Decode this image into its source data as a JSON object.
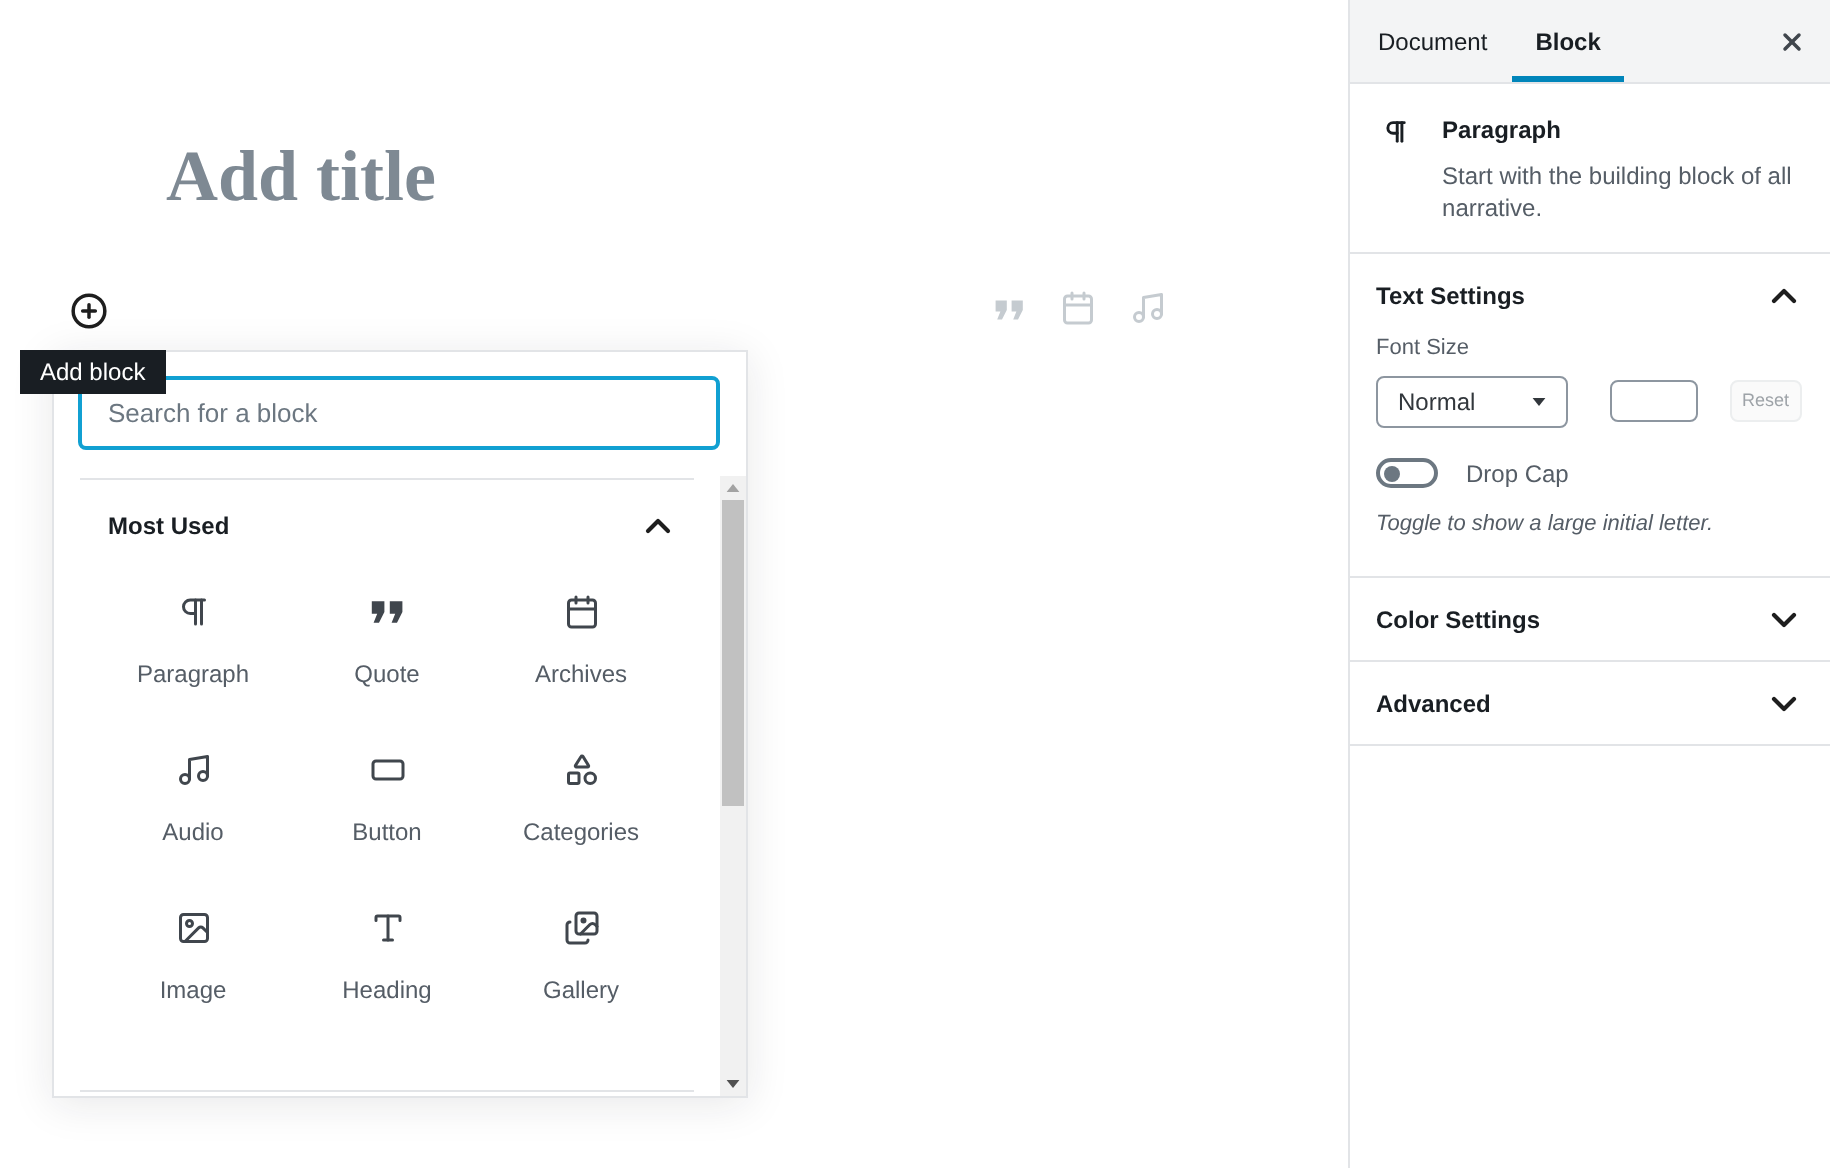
{
  "editor": {
    "title_placeholder": "Add title",
    "add_block_tooltip": "Add block"
  },
  "inserter": {
    "search": {
      "placeholder": "Search for a block"
    },
    "section": {
      "title": "Most Used",
      "expanded": true
    },
    "blocks": [
      {
        "label": "Paragraph",
        "kind": "paragraph"
      },
      {
        "label": "Quote",
        "kind": "quote"
      },
      {
        "label": "Archives",
        "kind": "archives"
      },
      {
        "label": "Audio",
        "kind": "audio"
      },
      {
        "label": "Button",
        "kind": "button"
      },
      {
        "label": "Categories",
        "kind": "categories"
      },
      {
        "label": "Image",
        "kind": "image"
      },
      {
        "label": "Heading",
        "kind": "heading"
      },
      {
        "label": "Gallery",
        "kind": "gallery"
      }
    ]
  },
  "sidebar": {
    "tabs": [
      {
        "label": "Document",
        "selected": false
      },
      {
        "label": "Block",
        "selected": true
      }
    ],
    "block_card": {
      "title": "Paragraph",
      "description": "Start with the building block of all narrative."
    },
    "panels": [
      {
        "title": "Text Settings",
        "expanded": true
      },
      {
        "title": "Color Settings",
        "expanded": false
      },
      {
        "title": "Advanced",
        "expanded": false
      }
    ],
    "text_settings": {
      "font_size_label": "Font Size",
      "font_size_value": "Normal",
      "reset": {
        "label": "Reset",
        "disabled": true
      },
      "drop_cap": {
        "label": "Drop Cap",
        "on": false
      },
      "help": "Toggle to show a large initial letter."
    }
  }
}
